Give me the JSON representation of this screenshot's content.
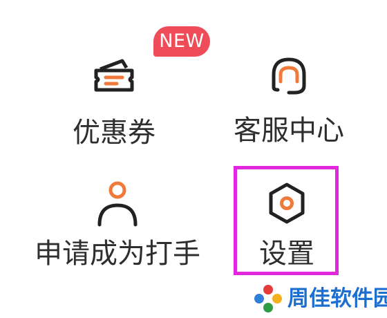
{
  "menu": {
    "items": [
      {
        "label": "优惠券",
        "icon": "ticket-icon"
      },
      {
        "label": "客服中心",
        "icon": "headset-icon"
      },
      {
        "label": "申请成为打手",
        "icon": "person-icon"
      },
      {
        "label": "设置",
        "icon": "hexagon-settings-icon"
      }
    ],
    "badge": "NEW"
  },
  "watermark": {
    "text": "周佳软件园"
  },
  "colors": {
    "accent": "#f07a3a",
    "badge": "#ef4c5a",
    "icon_stroke": "#222222",
    "highlight": "#e128de",
    "watermark_text": "#1c6fcf"
  }
}
